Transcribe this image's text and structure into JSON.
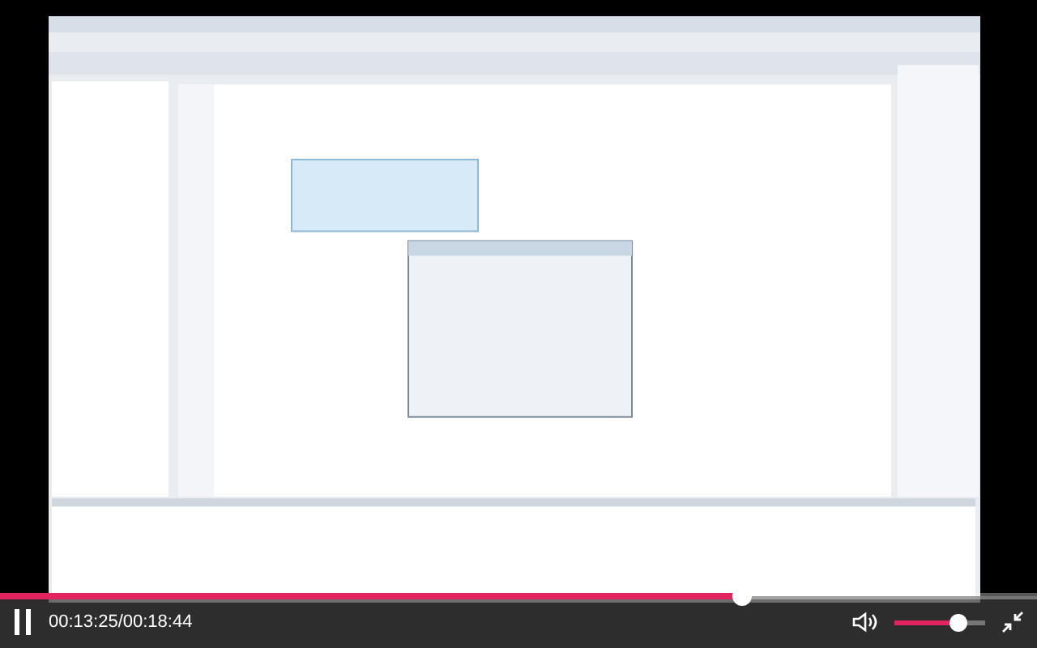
{
  "player": {
    "playing": true,
    "progress": {
      "level": 0.716
    },
    "time": "00:13:25/00:18:44",
    "volume": {
      "level": 0.7
    }
  }
}
